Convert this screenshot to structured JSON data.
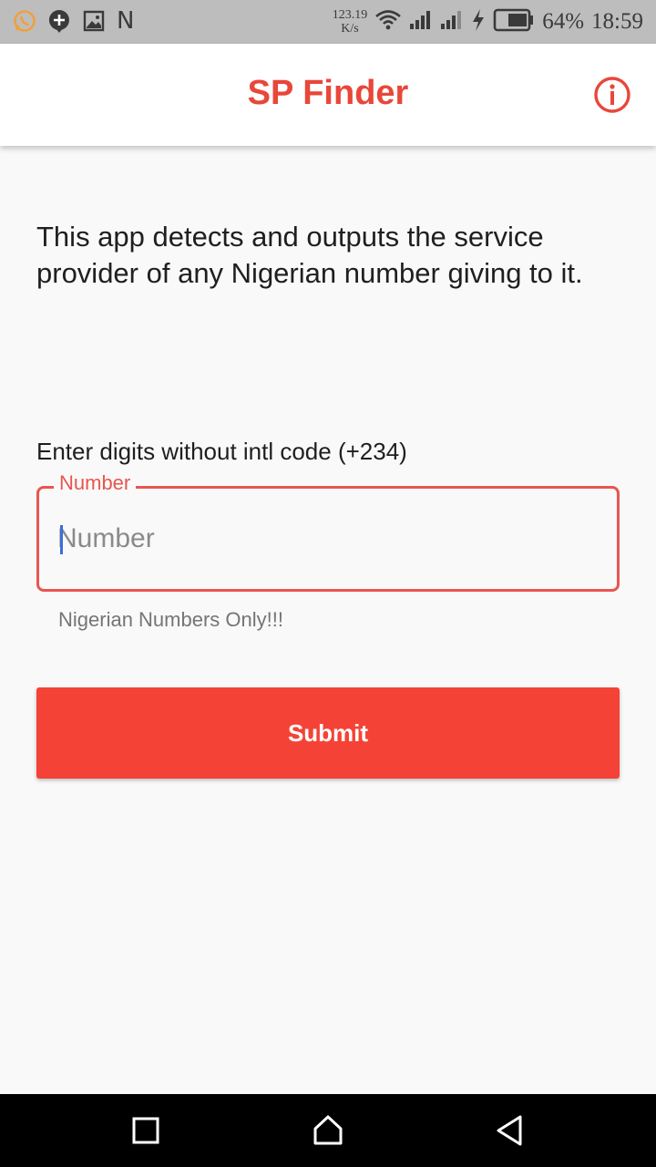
{
  "status_bar": {
    "net_speed_value": "123.19",
    "net_speed_unit": "K/s",
    "battery_percent": "64%",
    "time": "18:59",
    "left_icons": [
      "whatsapp-icon",
      "chat-plus-icon",
      "image-icon",
      "n-icon"
    ],
    "right_icons": [
      "wifi-icon",
      "signal-icon",
      "signal-icon",
      "charging-icon",
      "battery-icon"
    ],
    "n_glyph": "N"
  },
  "app_bar": {
    "title": "SP Finder",
    "action_icon": "info-icon"
  },
  "main": {
    "intro_text": "This app detects and outputs the service provider of any Nigerian number giving to it.",
    "input_label": "Enter digits without intl code (+234)",
    "number_field": {
      "floating_label": "Number",
      "placeholder": "Number",
      "value": "",
      "helper_text": "Nigerian Numbers Only!!!"
    },
    "submit_label": "Submit"
  },
  "nav_bar": {
    "buttons": [
      "recents-icon",
      "home-icon",
      "back-icon"
    ]
  },
  "colors": {
    "accent": "#e8473a",
    "field_border": "#e85650",
    "button": "#f44336",
    "status_bar": "#bdbdbd",
    "background": "#f9f9f9"
  }
}
